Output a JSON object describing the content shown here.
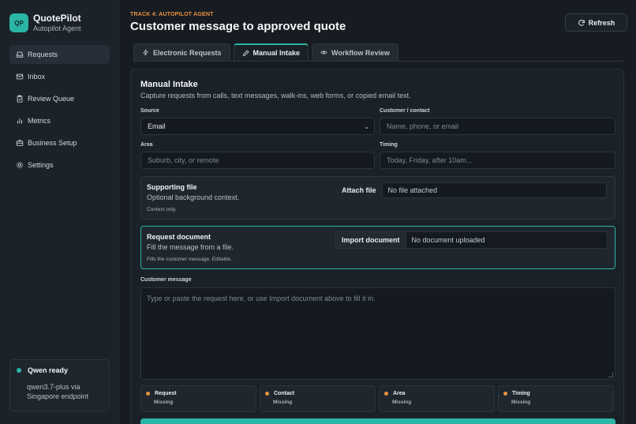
{
  "app": {
    "logo": "QP",
    "name": "QuotePilot",
    "subtitle": "Autopilot Agent"
  },
  "sidebar": {
    "items": [
      {
        "label": "Requests",
        "icon": "inbox-icon",
        "active": true
      },
      {
        "label": "Inbox",
        "icon": "mail-icon",
        "active": false
      },
      {
        "label": "Review Queue",
        "icon": "clipboard-icon",
        "active": false
      },
      {
        "label": "Metrics",
        "icon": "bar-chart-icon",
        "active": false
      },
      {
        "label": "Business Setup",
        "icon": "briefcase-icon",
        "active": false
      },
      {
        "label": "Settings",
        "icon": "gear-icon",
        "active": false
      }
    ],
    "status": {
      "title": "Qwen ready",
      "detail": "qwen3.7-plus via Singapore endpoint"
    }
  },
  "header": {
    "eyebrow": "TRACK 4: AUTOPILOT AGENT",
    "title": "Customer message to approved quote",
    "refresh_label": "Refresh"
  },
  "tabs": [
    {
      "label": "Electronic Requests",
      "icon": "bolt-icon",
      "active": false
    },
    {
      "label": "Manual Intake",
      "icon": "pencil-icon",
      "active": true
    },
    {
      "label": "Workflow Review",
      "icon": "eye-icon",
      "active": false
    }
  ],
  "intake": {
    "title": "Manual Intake",
    "subtitle": "Capture requests from calls, text messages, walk-ins, web forms, or copied email text.",
    "source": {
      "label": "Source",
      "value": "Email"
    },
    "contact": {
      "label": "Customer / contact",
      "placeholder": "Name, phone, or email"
    },
    "area": {
      "label": "Area",
      "placeholder": "Suburb, city, or remote"
    },
    "timing": {
      "label": "Timing",
      "placeholder": "Today, Friday, after 10am..."
    },
    "supporting_file": {
      "title": "Supporting file",
      "description": "Optional background context.",
      "note": "Context only.",
      "button": "Attach file",
      "status": "No file attached"
    },
    "request_document": {
      "title": "Request document",
      "description": "Fill the message from a file.",
      "note": "Fills the customer message. Editable.",
      "button": "Import document",
      "status": "No document uploaded"
    },
    "message": {
      "label": "Customer message",
      "placeholder": "Type or paste the request here, or use Import document above to fill it in."
    },
    "checks": [
      {
        "label": "Request",
        "status": "Missing"
      },
      {
        "label": "Contact",
        "status": "Missing"
      },
      {
        "label": "Area",
        "status": "Missing"
      },
      {
        "label": "Timing",
        "status": "Missing"
      }
    ]
  },
  "colors": {
    "accent": "#2bb5a4",
    "warning": "#e8913f",
    "background": "#171c22"
  }
}
